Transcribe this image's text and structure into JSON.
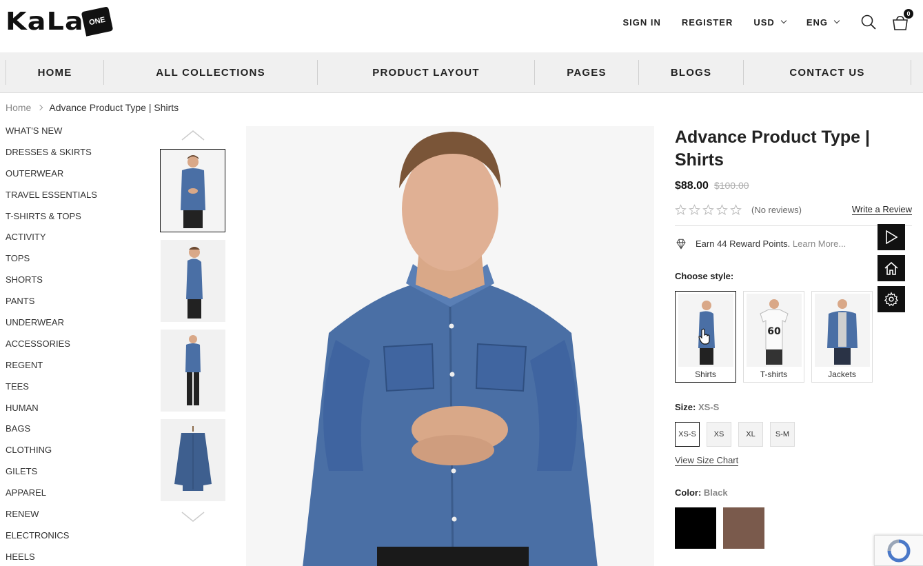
{
  "header": {
    "logo_text": "KaLa",
    "logo_badge": "ONE",
    "links": [
      "SIGN IN",
      "REGISTER"
    ],
    "currency": "USD",
    "language": "ENG",
    "cart_count": "0"
  },
  "nav": {
    "items": [
      "HOME",
      "ALL COLLECTIONS",
      "PRODUCT LAYOUT",
      "PAGES",
      "BLOGS",
      "CONTACT US"
    ]
  },
  "breadcrumb": {
    "home": "Home",
    "current": "Advance Product Type | Shirts"
  },
  "sidebar": {
    "items": [
      "WHAT'S NEW",
      "DRESSES & SKIRTS",
      "OUTERWEAR",
      "TRAVEL ESSENTIALS",
      "T-SHIRTS & TOPS",
      "ACTIVITY",
      "TOPS",
      "SHORTS",
      "PANTS",
      "UNDERWEAR",
      "ACCESSORIES",
      "REGENT",
      "TEES",
      "HUMAN",
      "BAGS",
      "CLOTHING",
      "GILETS",
      "APPAREL",
      "RENEW",
      "ELECTRONICS",
      "HEELS"
    ]
  },
  "product": {
    "title": "Advance Product Type | Shirts",
    "price": "$88.00",
    "old_price": "$100.00",
    "no_reviews": "(No reviews)",
    "write_review": "Write a Review",
    "reward_text": "Earn 44 Reward Points.",
    "reward_link": "Learn More...",
    "choose_style_label": "Choose style:",
    "styles": [
      "Shirts",
      "T-shirts",
      "Jackets"
    ],
    "size_label": "Size:",
    "size_selected": "XS-S",
    "sizes": [
      "XS-S",
      "XS",
      "XL",
      "S-M"
    ],
    "size_chart": "View Size Chart",
    "color_label": "Color:",
    "color_selected": "Black",
    "colors": [
      "#000000",
      "#7a5a4c"
    ]
  },
  "colors": {
    "accent": "#111111",
    "nav_bg": "#f0f0f0",
    "denim": "#4a6fa5"
  }
}
